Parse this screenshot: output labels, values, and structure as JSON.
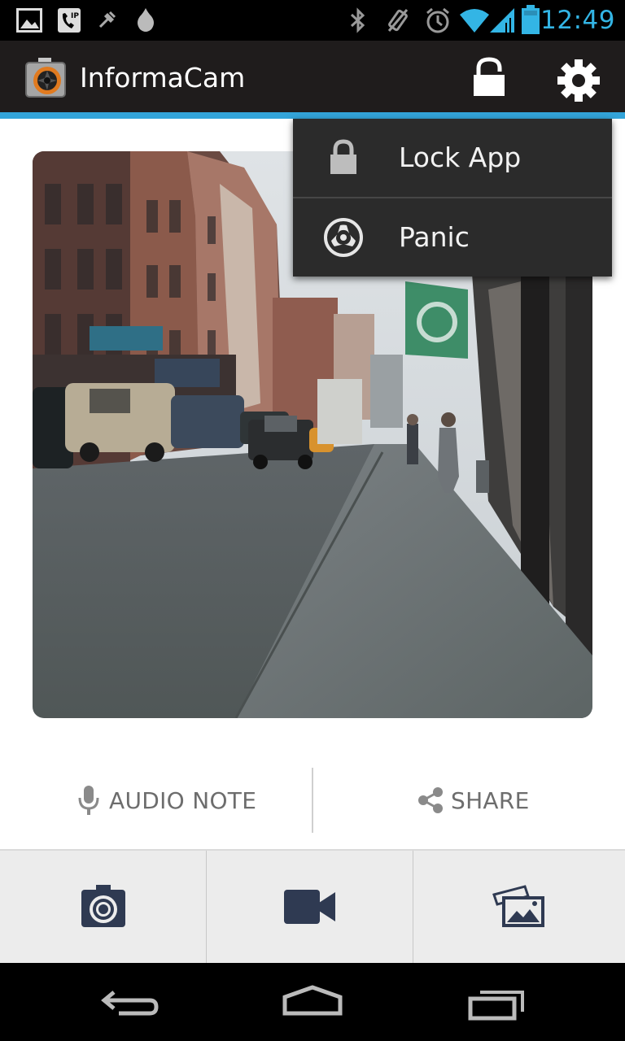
{
  "status_bar": {
    "time": "12:49",
    "left_icons": [
      "gallery-icon",
      "sip-call-icon",
      "usb-debug-icon",
      "orbot-icon"
    ],
    "right_icons": [
      "bluetooth-icon",
      "vibrate-icon",
      "alarm-icon",
      "wifi-icon",
      "signal-icon",
      "battery-icon"
    ],
    "accent_color": "#33b5e5"
  },
  "action_bar": {
    "title": "InformaCam",
    "actions": [
      "lock-icon",
      "settings-gear-icon"
    ],
    "background": "#1f1c1c",
    "underline_color": "#33a4d9"
  },
  "overflow_menu": {
    "items": [
      {
        "label": "Lock App",
        "icon": "lock-icon"
      },
      {
        "label": "Panic",
        "icon": "radiation-icon"
      }
    ]
  },
  "media_actions": {
    "audio_note": "AUDIO NOTE",
    "share": "SHARE"
  },
  "toolbar": {
    "buttons": [
      "camera-icon",
      "video-camera-icon",
      "gallery-icon"
    ]
  },
  "nav_bar": {
    "buttons": [
      "back-icon",
      "home-icon",
      "recent-apps-icon"
    ]
  }
}
